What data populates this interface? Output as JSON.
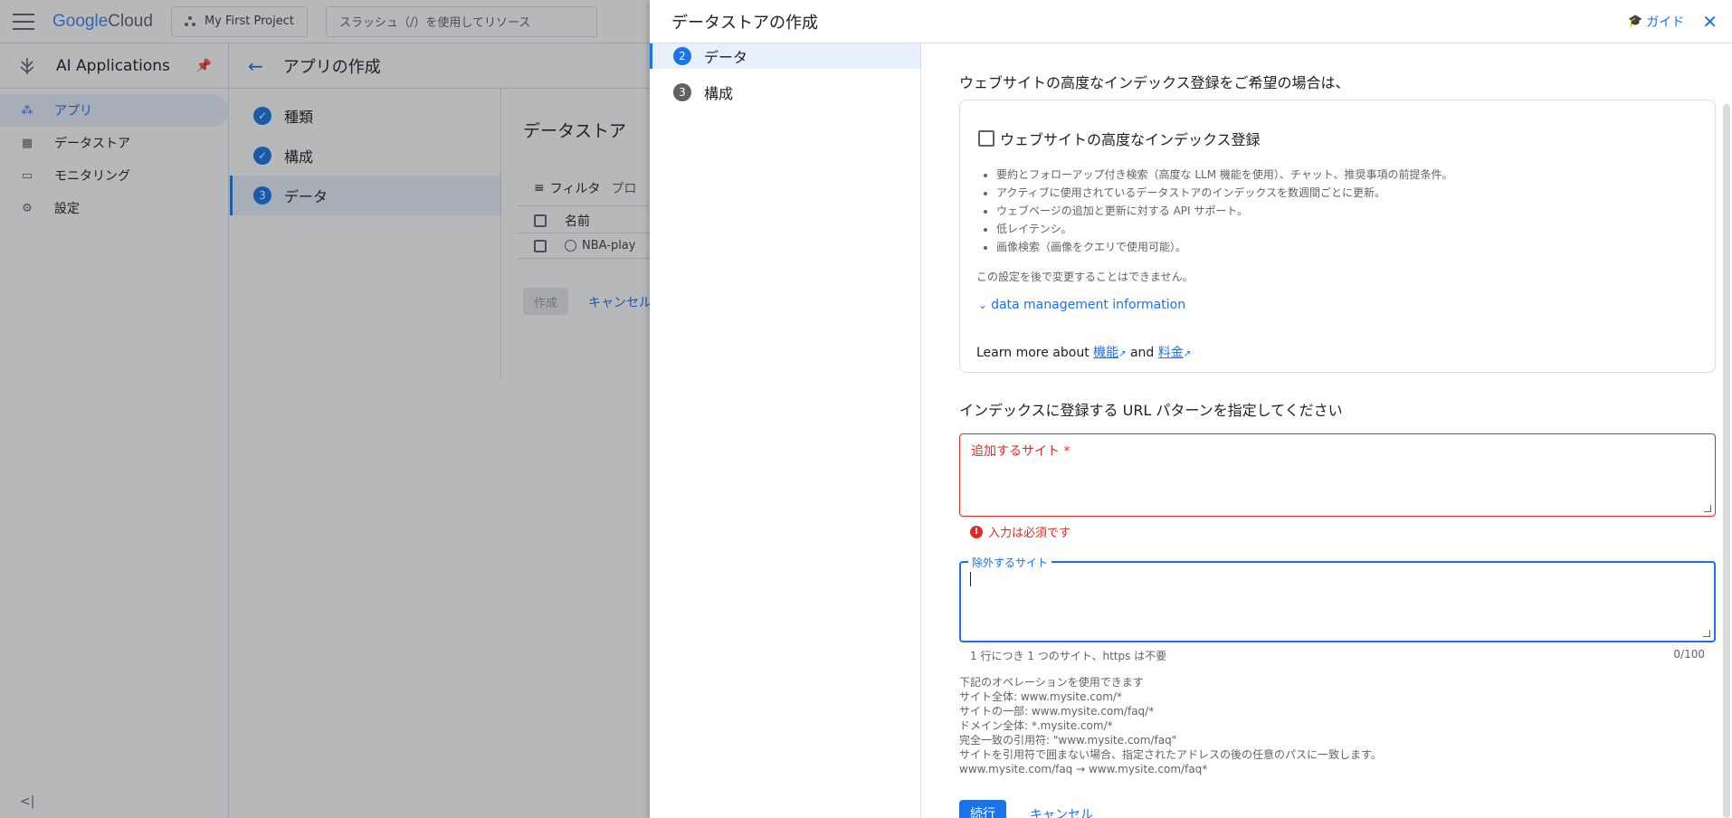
{
  "topbar": {
    "logo_google": "Google",
    "logo_cloud": " Cloud",
    "project_label": "My First Project",
    "search_placeholder": "スラッシュ（/）を使用してリソース"
  },
  "leftnav": {
    "product_title": "AI Applications",
    "items": [
      {
        "label": "アプリ",
        "icon": "apps-icon"
      },
      {
        "label": "データストア",
        "icon": "datastore-icon"
      },
      {
        "label": "モニタリング",
        "icon": "monitoring-icon"
      },
      {
        "label": "設定",
        "icon": "gear-icon"
      }
    ]
  },
  "main": {
    "page_title": "アプリの作成",
    "steps": [
      {
        "label": "種類",
        "state": "done"
      },
      {
        "label": "構成",
        "state": "done"
      },
      {
        "label": "データ",
        "number": "3",
        "state": "active"
      }
    ],
    "datastore_title": "データストア",
    "filter_label": "フィルタ",
    "filter_extra": "プロ",
    "col_name": "名前",
    "row_name": "NBA-play",
    "create_label": "作成",
    "cancel_label": "キャンセル"
  },
  "panel": {
    "title": "データストアの作成",
    "guide_label": "ガイド",
    "steps": [
      {
        "number": "2",
        "label": "データ",
        "state": "active"
      },
      {
        "number": "3",
        "label": "構成",
        "state": "upcoming"
      }
    ],
    "intro": "ウェブサイトの高度なインデックス登録をご希望の場合は、",
    "advanced_label": "ウェブサイトの高度なインデックス登録",
    "bullets": [
      "要約とフォローアップ付き検索（高度な LLM 機能を使用）、チャット、推奨事項の前提条件。",
      "アクティブに使用されているデータストアのインデックスを数週間ごとに更新。",
      "ウェブページの追加と更新に対する API サポート。",
      "低レイテンシ。",
      "画像検索（画像をクエリで使用可能）。"
    ],
    "note": "この設定を後で変更することはできません。",
    "dmi_link": "data management information",
    "learn_prefix": "Learn more about ",
    "learn_feature": "機能",
    "learn_and": " and ",
    "learn_price": "料金",
    "url_title": "インデックスに登録する URL パターンを指定してください",
    "add_sites_label": "追加するサイト *",
    "error_text": "入力は必須です",
    "exclude_label": "除外するサイト",
    "hint": "1 行につき 1 つのサイト、https は不要",
    "counter": "0/100",
    "ops": [
      "下記のオペレーションを使用できます",
      "サイト全体: www.mysite.com/*",
      "サイトの一部: www.mysite.com/faq/*",
      "ドメイン全体: *.mysite.com/*",
      "完全一致の引用符: \"www.mysite.com/faq\"",
      "サイトを引用符で囲まない場合、指定されたアドレスの後の任意のパスに一致します。",
      "www.mysite.com/faq → www.mysite.com/faq*"
    ],
    "continue_label": "続行",
    "cancel_label": "キャンセル"
  }
}
